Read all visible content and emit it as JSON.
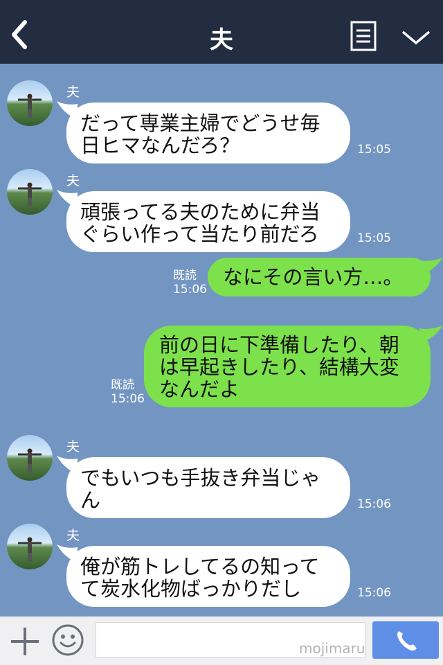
{
  "header": {
    "title": "夫"
  },
  "messages": [
    {
      "direction": "in",
      "sender": "夫",
      "text": "だって専業主婦でどうせ毎\n日ヒマなんだろ？",
      "time": "15:05"
    },
    {
      "direction": "in",
      "sender": "夫",
      "text": "頑張ってる夫のために弁当\nぐらい作って当たり前だろ",
      "time": "15:05"
    },
    {
      "direction": "out",
      "read": "既読",
      "text": "なにその言い方…。",
      "time": "15:06"
    },
    {
      "direction": "out",
      "read": "既読",
      "text": "前の日に下準備したり、朝\nは早起きしたり、結構大変\nなんだよ",
      "time": "15:06"
    },
    {
      "direction": "in",
      "sender": "夫",
      "text": "でもいつも手抜き弁当じゃ\nん",
      "time": "15:06"
    },
    {
      "direction": "in",
      "sender": "夫",
      "text": "俺が筋トレしてるの知って\nて炭水化物ばっかりだし",
      "time": "15:06"
    }
  ],
  "composer": {
    "input_value": "",
    "watermark": "mojimaru"
  },
  "colors": {
    "header_bg": "#232d41",
    "chat_bg": "#7395c2",
    "incoming_bubble": "#ffffff",
    "outgoing_bubble": "#7ce14b",
    "call_button": "#5e8ee6"
  },
  "icons": {
    "back": "chevron-left-icon",
    "menu": "notes-icon",
    "collapse": "chevron-down-icon",
    "add": "plus-icon",
    "emoji": "smiley-icon",
    "call": "phone-icon"
  }
}
